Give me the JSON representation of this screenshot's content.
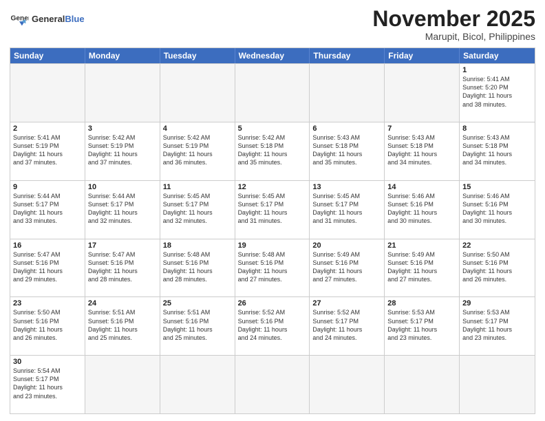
{
  "header": {
    "logo_general": "General",
    "logo_blue": "Blue",
    "month_title": "November 2025",
    "location": "Marupit, Bicol, Philippines"
  },
  "weekdays": [
    "Sunday",
    "Monday",
    "Tuesday",
    "Wednesday",
    "Thursday",
    "Friday",
    "Saturday"
  ],
  "weeks": [
    [
      {
        "day": "",
        "info": "",
        "empty": true
      },
      {
        "day": "",
        "info": "",
        "empty": true
      },
      {
        "day": "",
        "info": "",
        "empty": true
      },
      {
        "day": "",
        "info": "",
        "empty": true
      },
      {
        "day": "",
        "info": "",
        "empty": true
      },
      {
        "day": "",
        "info": "",
        "empty": true
      },
      {
        "day": "1",
        "info": "Sunrise: 5:41 AM\nSunset: 5:20 PM\nDaylight: 11 hours\nand 38 minutes.",
        "empty": false
      }
    ],
    [
      {
        "day": "2",
        "info": "Sunrise: 5:41 AM\nSunset: 5:19 PM\nDaylight: 11 hours\nand 37 minutes.",
        "empty": false
      },
      {
        "day": "3",
        "info": "Sunrise: 5:42 AM\nSunset: 5:19 PM\nDaylight: 11 hours\nand 37 minutes.",
        "empty": false
      },
      {
        "day": "4",
        "info": "Sunrise: 5:42 AM\nSunset: 5:19 PM\nDaylight: 11 hours\nand 36 minutes.",
        "empty": false
      },
      {
        "day": "5",
        "info": "Sunrise: 5:42 AM\nSunset: 5:18 PM\nDaylight: 11 hours\nand 35 minutes.",
        "empty": false
      },
      {
        "day": "6",
        "info": "Sunrise: 5:43 AM\nSunset: 5:18 PM\nDaylight: 11 hours\nand 35 minutes.",
        "empty": false
      },
      {
        "day": "7",
        "info": "Sunrise: 5:43 AM\nSunset: 5:18 PM\nDaylight: 11 hours\nand 34 minutes.",
        "empty": false
      },
      {
        "day": "8",
        "info": "Sunrise: 5:43 AM\nSunset: 5:18 PM\nDaylight: 11 hours\nand 34 minutes.",
        "empty": false
      }
    ],
    [
      {
        "day": "9",
        "info": "Sunrise: 5:44 AM\nSunset: 5:17 PM\nDaylight: 11 hours\nand 33 minutes.",
        "empty": false
      },
      {
        "day": "10",
        "info": "Sunrise: 5:44 AM\nSunset: 5:17 PM\nDaylight: 11 hours\nand 32 minutes.",
        "empty": false
      },
      {
        "day": "11",
        "info": "Sunrise: 5:45 AM\nSunset: 5:17 PM\nDaylight: 11 hours\nand 32 minutes.",
        "empty": false
      },
      {
        "day": "12",
        "info": "Sunrise: 5:45 AM\nSunset: 5:17 PM\nDaylight: 11 hours\nand 31 minutes.",
        "empty": false
      },
      {
        "day": "13",
        "info": "Sunrise: 5:45 AM\nSunset: 5:17 PM\nDaylight: 11 hours\nand 31 minutes.",
        "empty": false
      },
      {
        "day": "14",
        "info": "Sunrise: 5:46 AM\nSunset: 5:16 PM\nDaylight: 11 hours\nand 30 minutes.",
        "empty": false
      },
      {
        "day": "15",
        "info": "Sunrise: 5:46 AM\nSunset: 5:16 PM\nDaylight: 11 hours\nand 30 minutes.",
        "empty": false
      }
    ],
    [
      {
        "day": "16",
        "info": "Sunrise: 5:47 AM\nSunset: 5:16 PM\nDaylight: 11 hours\nand 29 minutes.",
        "empty": false
      },
      {
        "day": "17",
        "info": "Sunrise: 5:47 AM\nSunset: 5:16 PM\nDaylight: 11 hours\nand 28 minutes.",
        "empty": false
      },
      {
        "day": "18",
        "info": "Sunrise: 5:48 AM\nSunset: 5:16 PM\nDaylight: 11 hours\nand 28 minutes.",
        "empty": false
      },
      {
        "day": "19",
        "info": "Sunrise: 5:48 AM\nSunset: 5:16 PM\nDaylight: 11 hours\nand 27 minutes.",
        "empty": false
      },
      {
        "day": "20",
        "info": "Sunrise: 5:49 AM\nSunset: 5:16 PM\nDaylight: 11 hours\nand 27 minutes.",
        "empty": false
      },
      {
        "day": "21",
        "info": "Sunrise: 5:49 AM\nSunset: 5:16 PM\nDaylight: 11 hours\nand 27 minutes.",
        "empty": false
      },
      {
        "day": "22",
        "info": "Sunrise: 5:50 AM\nSunset: 5:16 PM\nDaylight: 11 hours\nand 26 minutes.",
        "empty": false
      }
    ],
    [
      {
        "day": "23",
        "info": "Sunrise: 5:50 AM\nSunset: 5:16 PM\nDaylight: 11 hours\nand 26 minutes.",
        "empty": false
      },
      {
        "day": "24",
        "info": "Sunrise: 5:51 AM\nSunset: 5:16 PM\nDaylight: 11 hours\nand 25 minutes.",
        "empty": false
      },
      {
        "day": "25",
        "info": "Sunrise: 5:51 AM\nSunset: 5:16 PM\nDaylight: 11 hours\nand 25 minutes.",
        "empty": false
      },
      {
        "day": "26",
        "info": "Sunrise: 5:52 AM\nSunset: 5:16 PM\nDaylight: 11 hours\nand 24 minutes.",
        "empty": false
      },
      {
        "day": "27",
        "info": "Sunrise: 5:52 AM\nSunset: 5:17 PM\nDaylight: 11 hours\nand 24 minutes.",
        "empty": false
      },
      {
        "day": "28",
        "info": "Sunrise: 5:53 AM\nSunset: 5:17 PM\nDaylight: 11 hours\nand 23 minutes.",
        "empty": false
      },
      {
        "day": "29",
        "info": "Sunrise: 5:53 AM\nSunset: 5:17 PM\nDaylight: 11 hours\nand 23 minutes.",
        "empty": false
      }
    ],
    [
      {
        "day": "30",
        "info": "Sunrise: 5:54 AM\nSunset: 5:17 PM\nDaylight: 11 hours\nand 23 minutes.",
        "empty": false
      },
      {
        "day": "",
        "info": "",
        "empty": true
      },
      {
        "day": "",
        "info": "",
        "empty": true
      },
      {
        "day": "",
        "info": "",
        "empty": true
      },
      {
        "day": "",
        "info": "",
        "empty": true
      },
      {
        "day": "",
        "info": "",
        "empty": true
      },
      {
        "day": "",
        "info": "",
        "empty": true
      }
    ]
  ]
}
